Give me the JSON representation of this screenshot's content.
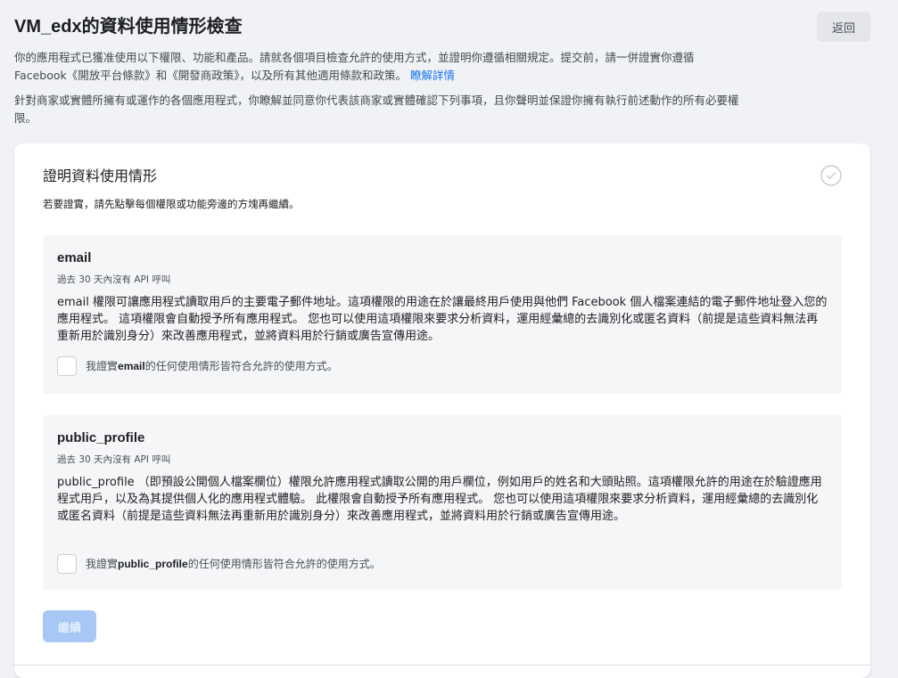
{
  "header": {
    "title": "VM_edx的資料使用情形檢查",
    "back_label": "返回"
  },
  "intro": {
    "paragraph1": "你的應用程式已獲准使用以下權限、功能和產品。請就各個項目檢查允許的使用方式，並證明你遵循相關規定。提交前，請一併證實你遵循 Facebook《開放平台條款》和《開發商政策》，以及所有其他適用條款和政策。",
    "learn_more": "瞭解詳情",
    "paragraph2": "針對商家或實體所擁有或運作的各個應用程式，你瞭解並同意你代表該商家或實體確認下列事項，且你聲明並保證你擁有執行前述動作的所有必要權限。"
  },
  "card": {
    "title": "證明資料使用情形",
    "subtitle": "若要證實，請先點擊每個權限或功能旁邊的方塊再繼續。",
    "icon": "check-circle-icon",
    "continue_label": "繼續"
  },
  "permissions": {
    "email": {
      "name": "email",
      "usage": "過去 30 天內沒有 API 呼叫",
      "description": "email 權限可讓應用程式讀取用戶的主要電子郵件地址。這項權限的用途在於讓最終用戶使用與他們 Facebook 個人檔案連結的電子郵件地址登入您的應用程式。 這項權限會自動授予所有應用程式。 您也可以使用這項權限來要求分析資料，運用經彙總的去識別化或匿名資料（前提是這些資料無法再重新用於識別身分）來改善應用程式，並將資料用於行銷或廣告宣傳用途。",
      "certify_prefix": "我證實",
      "certify_name": "email",
      "certify_suffix": "的任何使用情形皆符合允許的使用方式。"
    },
    "public_profile": {
      "name": "public_profile",
      "usage": "過去 30 天內沒有 API 呼叫",
      "description": "public_profile （即預設公開個人檔案欄位）權限允許應用程式讀取公開的用戶欄位，例如用戶的姓名和大頭貼照。這項權限允許的用途在於驗證應用程式用戶，以及為其提供個人化的應用程式體驗。 此權限會自動授予所有應用程式。 您也可以使用這項權限來要求分析資料，運用經彙總的去識別化或匿名資料（前提是這些資料無法再重新用於識別身分）來改善應用程式，並將資料用於行銷或廣告宣傳用途。",
      "certify_prefix": "我證實",
      "certify_name": "public_profile",
      "certify_suffix": "的任何使用情形皆符合允許的使用方式。"
    }
  },
  "colors": {
    "background": "#f0f2f5",
    "link": "#1877f2",
    "continue_disabled": "#a7c7f4",
    "permission_box": "#f5f6f7"
  }
}
